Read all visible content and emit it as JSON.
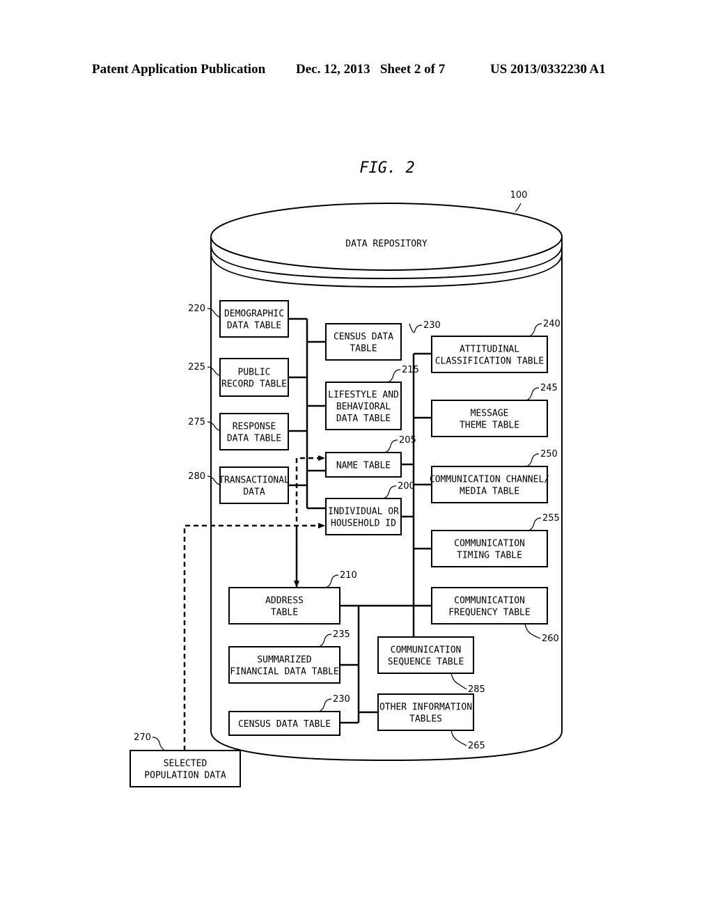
{
  "header": {
    "left": "Patent Application Publication",
    "middle": "Dec. 12, 2013   Sheet 2 of 7",
    "right": "US 2013/0332230 A1"
  },
  "figure": {
    "title": "FIG. 2",
    "repository": {
      "ref": "100",
      "label": "DATA REPOSITORY"
    },
    "boxes": [
      {
        "id": "220",
        "lines": [
          "DEMOGRAPHIC",
          "DATA TABLE"
        ]
      },
      {
        "id": "225",
        "lines": [
          "PUBLIC",
          "RECORD TABLE"
        ]
      },
      {
        "id": "275",
        "lines": [
          "RESPONSE",
          "DATA TABLE"
        ]
      },
      {
        "id": "280",
        "lines": [
          "TRANSACTIONAL",
          "DATA"
        ]
      },
      {
        "id": "230a",
        "ref": "230",
        "lines": [
          "CENSUS DATA",
          "TABLE"
        ]
      },
      {
        "id": "215",
        "lines": [
          "LIFESTYLE AND",
          "BEHAVIORAL",
          "DATA TABLE"
        ]
      },
      {
        "id": "205",
        "lines": [
          "NAME TABLE"
        ]
      },
      {
        "id": "200",
        "lines": [
          "INDIVIDUAL OR",
          "HOUSEHOLD ID"
        ]
      },
      {
        "id": "240",
        "lines": [
          "ATTITUDINAL",
          "CLASSIFICATION TABLE"
        ]
      },
      {
        "id": "245",
        "lines": [
          "MESSAGE",
          "THEME TABLE"
        ]
      },
      {
        "id": "250",
        "lines": [
          "COMMUNICATION CHANNEL/",
          "MEDIA TABLE"
        ]
      },
      {
        "id": "255",
        "lines": [
          "COMMUNICATION",
          "TIMING TABLE"
        ]
      },
      {
        "id": "260",
        "lines": [
          "COMMUNICATION",
          "FREQUENCY TABLE"
        ]
      },
      {
        "id": "210",
        "lines": [
          "ADDRESS",
          "TABLE"
        ]
      },
      {
        "id": "235",
        "lines": [
          "SUMMARIZED",
          "FINANCIAL DATA TABLE"
        ]
      },
      {
        "id": "230b",
        "ref": "230",
        "lines": [
          "CENSUS DATA TABLE"
        ]
      },
      {
        "id": "285",
        "lines": [
          "COMMUNICATION",
          "SEQUENCE TABLE"
        ]
      },
      {
        "id": "265",
        "lines": [
          "OTHER INFORMATION",
          "TABLES"
        ]
      },
      {
        "id": "270",
        "lines": [
          "SELECTED",
          "POPULATION DATA"
        ]
      }
    ],
    "connections": [
      {
        "from": "220",
        "to": "bus-left",
        "style": "solid"
      },
      {
        "from": "225",
        "to": "bus-left",
        "style": "solid"
      },
      {
        "from": "275",
        "to": "bus-left",
        "style": "solid"
      },
      {
        "from": "280",
        "to": "bus-left",
        "style": "solid"
      },
      {
        "from": "bus-left",
        "to": "230a",
        "style": "solid"
      },
      {
        "from": "bus-left",
        "to": "215",
        "style": "solid"
      },
      {
        "from": "bus-left",
        "to": "205",
        "style": "solid"
      },
      {
        "from": "bus-left",
        "to": "200",
        "style": "solid"
      },
      {
        "from": "205",
        "to": "bus-right",
        "style": "solid"
      },
      {
        "from": "200",
        "to": "bus-right",
        "style": "solid"
      },
      {
        "from": "bus-right",
        "to": "240",
        "style": "solid"
      },
      {
        "from": "bus-right",
        "to": "245",
        "style": "solid"
      },
      {
        "from": "bus-right",
        "to": "250",
        "style": "solid"
      },
      {
        "from": "bus-right",
        "to": "255",
        "style": "solid"
      },
      {
        "from": "bus-right",
        "to": "260",
        "style": "solid"
      },
      {
        "from": "bus-right",
        "to": "285",
        "style": "solid"
      },
      {
        "from": "210",
        "to": "bus-right",
        "style": "solid"
      },
      {
        "from": "210",
        "to": "bus-bottom",
        "style": "solid"
      },
      {
        "from": "235",
        "to": "bus-bottom",
        "style": "solid"
      },
      {
        "from": "230b",
        "to": "bus-bottom",
        "style": "solid"
      },
      {
        "from": "bus-bottom",
        "to": "265",
        "style": "solid"
      },
      {
        "from": "210",
        "to": "205",
        "style": "dashed-arrow"
      },
      {
        "from": "205",
        "to": "210",
        "style": "dashed-arrow"
      },
      {
        "from": "270",
        "to": "200",
        "style": "dashed-arrow"
      }
    ]
  }
}
